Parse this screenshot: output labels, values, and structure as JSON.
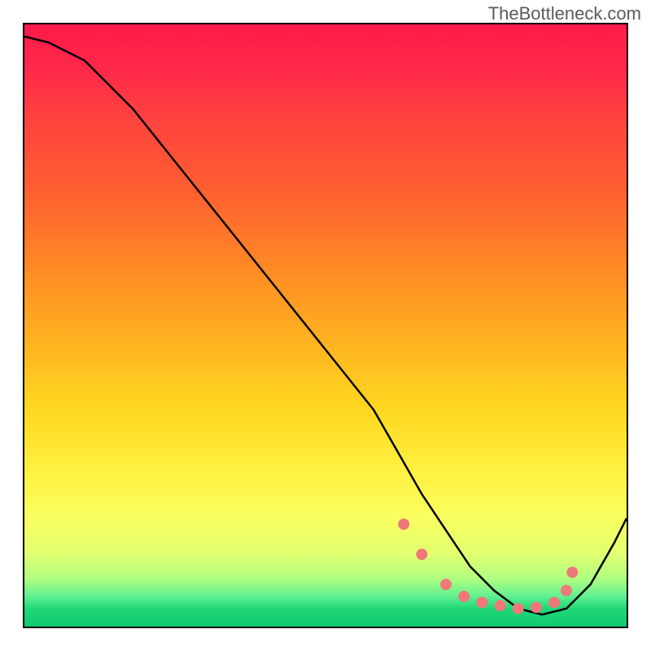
{
  "watermark": "TheBottleneck.com",
  "chart_data": {
    "type": "line",
    "title": "",
    "xlabel": "",
    "ylabel": "",
    "xlim": [
      0,
      100
    ],
    "ylim": [
      0,
      100
    ],
    "grid": false,
    "legend": false,
    "series": [
      {
        "name": "bottleneck-curve",
        "color": "#000000",
        "x": [
          0,
          4,
          10,
          18,
          26,
          34,
          42,
          50,
          58,
          62,
          66,
          70,
          74,
          78,
          82,
          86,
          90,
          94,
          98,
          100
        ],
        "y": [
          98,
          97,
          94,
          86,
          76,
          66,
          56,
          46,
          36,
          29,
          22,
          16,
          10,
          6,
          3,
          2,
          3,
          7,
          14,
          18
        ]
      }
    ],
    "markers": {
      "name": "highlight-dots",
      "color": "#f07878",
      "radius": 7,
      "x": [
        63,
        66,
        70,
        73,
        76,
        79,
        82,
        85,
        88,
        90,
        91
      ],
      "y": [
        17,
        12,
        7,
        5,
        4,
        3.5,
        3,
        3.2,
        4,
        6,
        9
      ]
    },
    "background": {
      "type": "vertical-gradient",
      "stops": [
        {
          "pos": 0,
          "color": "#ff1a4a"
        },
        {
          "pos": 40,
          "color": "#ff8825"
        },
        {
          "pos": 74,
          "color": "#fff040"
        },
        {
          "pos": 92,
          "color": "#b0ff80"
        },
        {
          "pos": 100,
          "color": "#10c870"
        }
      ]
    }
  }
}
